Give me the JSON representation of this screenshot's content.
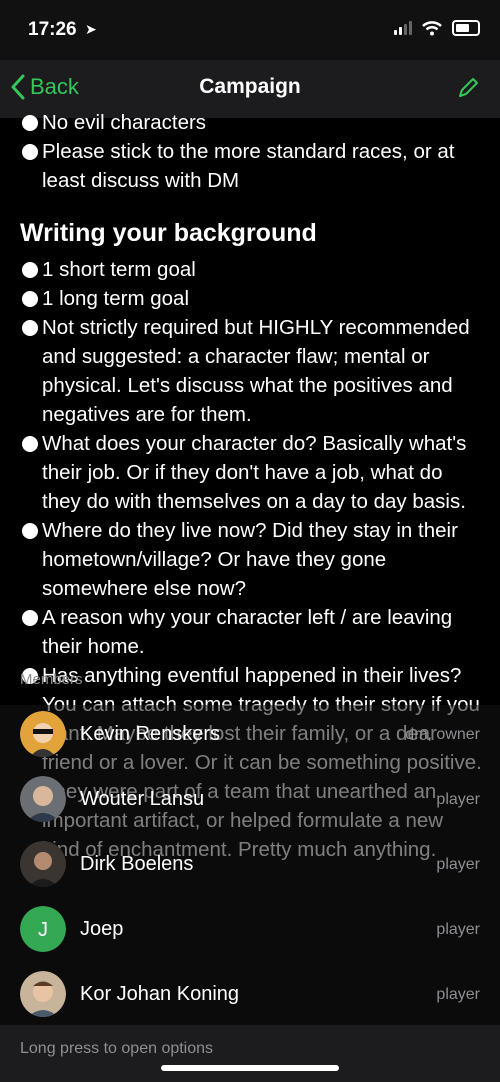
{
  "status": {
    "time": "17:26"
  },
  "nav": {
    "back_label": "Back",
    "title": "Campaign"
  },
  "content": {
    "top_items": [
      "No evil characters",
      "Please stick to the more standard races, or at least discuss with DM"
    ],
    "section_heading": "Writing your background",
    "items": [
      "1 short term goal",
      "1 long term goal",
      "Not strictly required but HIGHLY recommended and suggested: a character flaw; mental or physical. Let's discuss what the positives and negatives are for them.",
      "What does your character do? Basically what's their job. Or if they don't have a job, what do they do with themselves on a day to day basis.",
      "Where do they live now? Did they stay in their hometown/village? Or have they gone somewhere else now?",
      "A reason why your character left / are leaving their home.",
      "Has anything eventful happened in their lives? You can attach some tragedy to their story if you want. Maybe they lost their family, or a dear friend or a lover. Or it can be something positive. They were part of a team that unearthed an important artifact, or helped formulate a new kind of enchantment. Pretty much anything."
    ]
  },
  "members": {
    "label": "Members",
    "list": [
      {
        "name": "Kevin Renskers",
        "role": "dm, owner"
      },
      {
        "name": "Wouter Lansu",
        "role": "player"
      },
      {
        "name": "Dirk Boelens",
        "role": "player"
      },
      {
        "name": "Joep",
        "role": "player",
        "initial": "J"
      },
      {
        "name": "Kor Johan Koning",
        "role": "player"
      }
    ]
  },
  "footer": {
    "hint": "Long press to open options"
  },
  "colors": {
    "accent": "#34c759",
    "background": "#000000",
    "secondary_text": "#8e8e93"
  }
}
